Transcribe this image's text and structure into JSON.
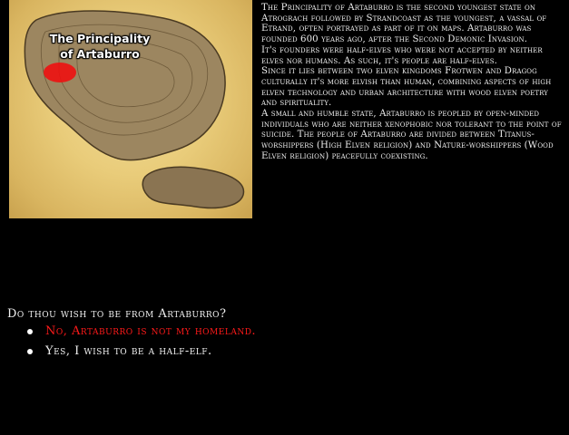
{
  "map": {
    "label_line1": "The Principality",
    "label_line2": "of Artaburro",
    "highlight_color": "#ee1111"
  },
  "description": {
    "paragraphs": [
      "The Principality of Artaburro is the second youngest state on Atrograch followed by Strandcoast as the youngest, a vassal of Etrand, often portrayed as part of it on maps. Artaburro was founded 600 years ago, after the Second Demonic Invasion.",
      "It's founders were half-elves who were not accepted by neither elves nor humans. As such, it's people are half-elves.",
      "Since it lies between two elven kingdoms Frotwen and Dragog culturally it's more elvish than human, combining aspects of high elven technology and urban architecture with wood elven poetry and spirituality.",
      "A small and humble state, Artaburro is peopled by open-minded individuals who are neither xenophobic nor tolerant to the point of suicide. The people of Artaburro are divided between Titanus-worshippers (High Elven religion) and Nature-worshippers (Wood Elven religion) peacefully coexisting."
    ]
  },
  "question": "Do thou wish to be from Artaburro?",
  "options": [
    {
      "label": "No, Artaburro is not my homeland.",
      "selected": true
    },
    {
      "label": "Yes, I wish to be a half-elf.",
      "selected": false
    }
  ],
  "colors": {
    "selected": "#ff1a1a",
    "text": "#f0f0f0",
    "background": "#000000"
  }
}
